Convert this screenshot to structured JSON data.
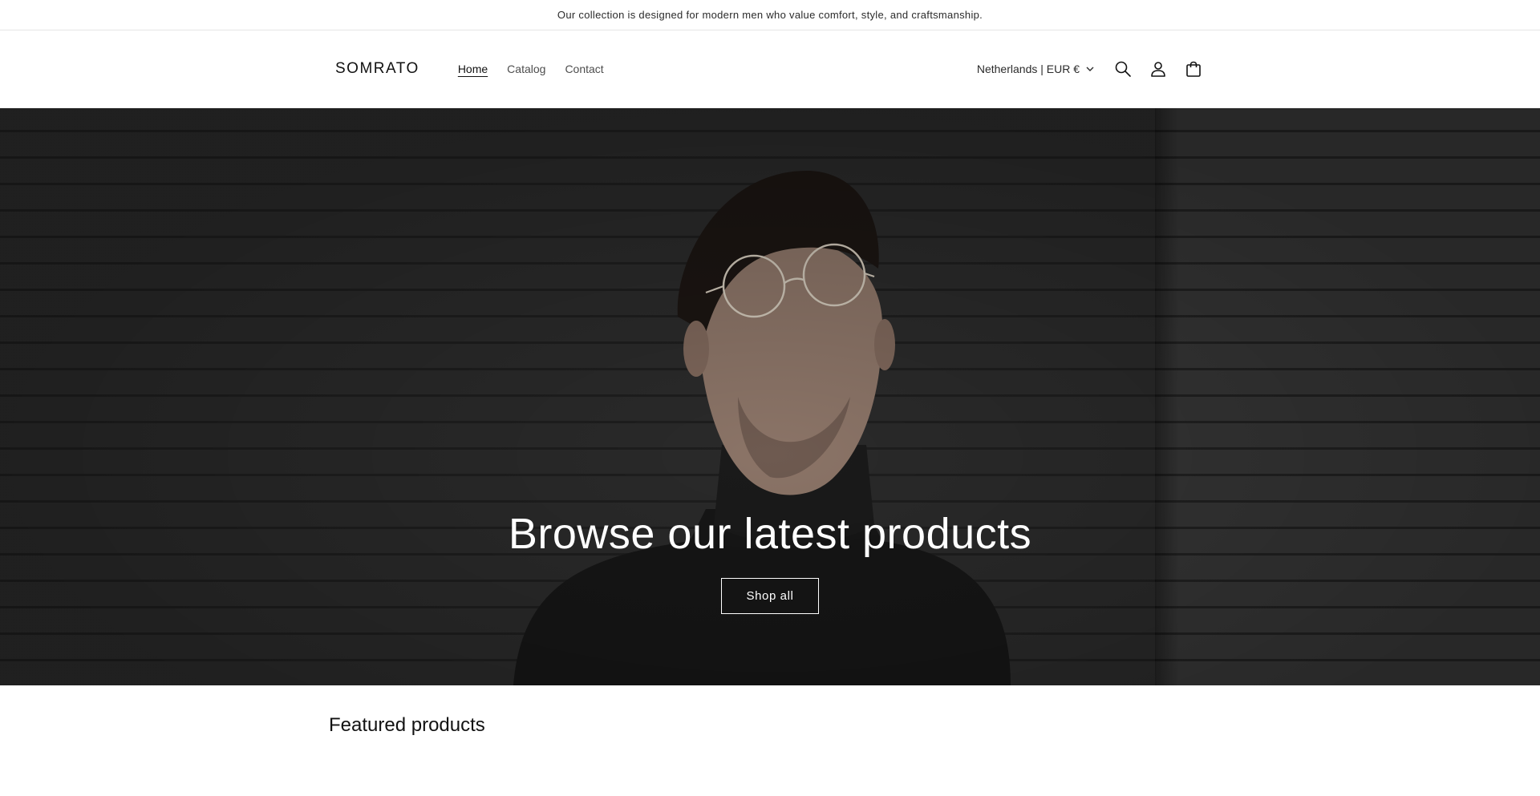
{
  "announcement": {
    "text": "Our collection is designed for modern men who value comfort, style, and craftsmanship."
  },
  "header": {
    "logo": "SOMRATO",
    "nav": [
      {
        "label": "Home",
        "active": true
      },
      {
        "label": "Catalog",
        "active": false
      },
      {
        "label": "Contact",
        "active": false
      }
    ],
    "country_selector": "Netherlands | EUR €",
    "icons": [
      "search-icon",
      "account-icon",
      "cart-icon"
    ]
  },
  "hero": {
    "title": "Browse our latest products",
    "button_label": "Shop all"
  },
  "featured": {
    "title": "Featured products"
  }
}
